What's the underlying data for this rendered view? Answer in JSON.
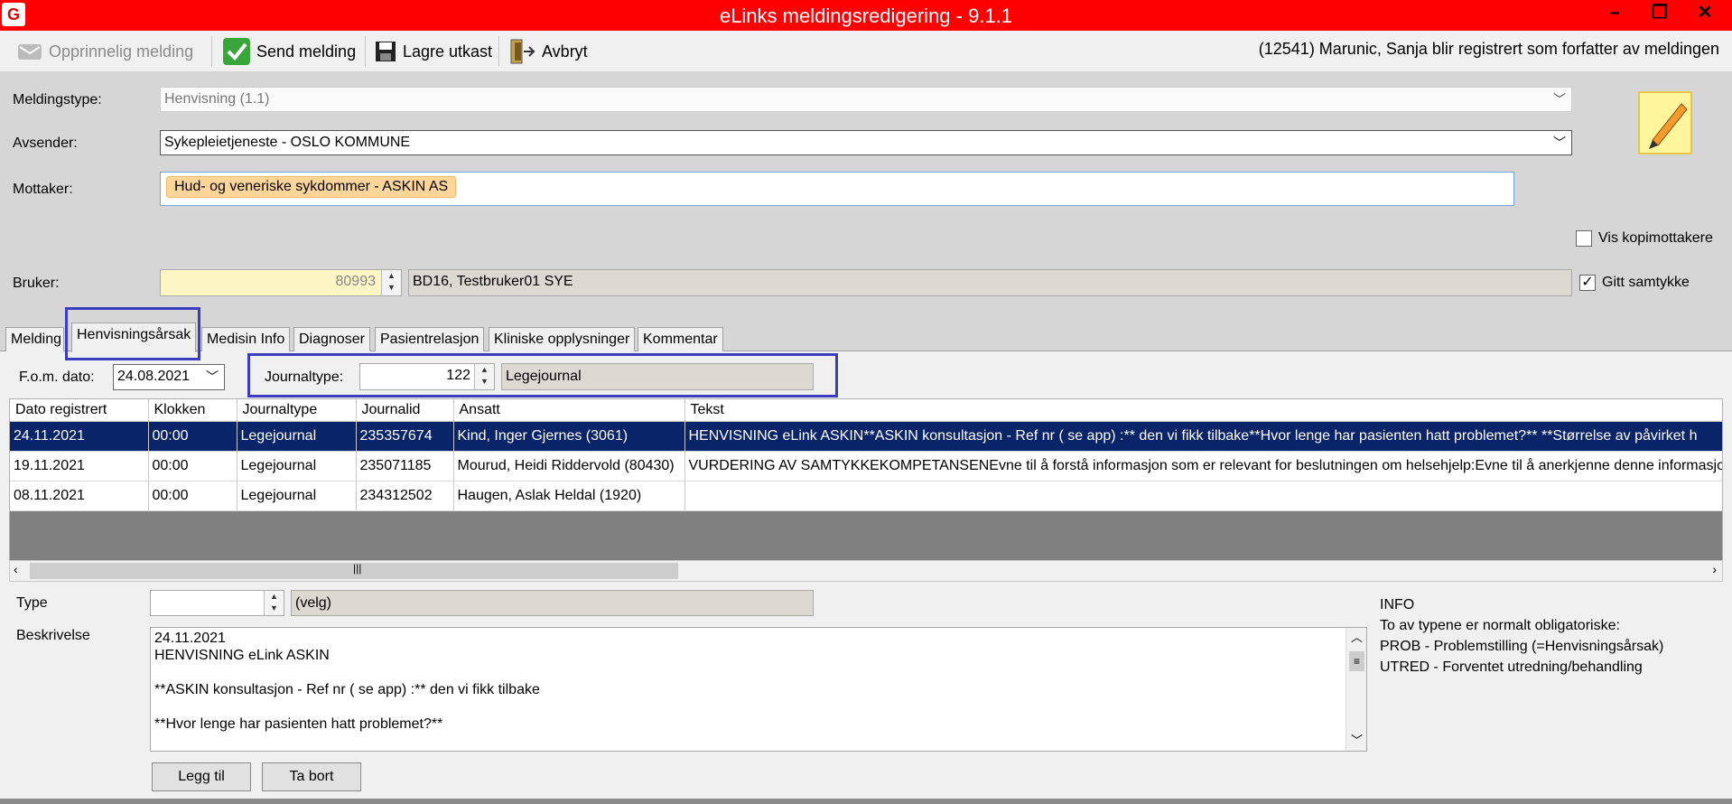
{
  "window": {
    "title": "eLinks meldingsredigering - 9.1.1",
    "app_icon": "G",
    "controls": [
      "minimize-icon",
      "restore-icon",
      "close-icon"
    ]
  },
  "toolbar": {
    "original_label": "Opprinnelig melding",
    "send_label": "Send melding",
    "save_label": "Lagre utkast",
    "cancel_label": "Avbryt",
    "author_note": "(12541) Marunic, Sanja blir registrert som forfatter av meldingen"
  },
  "form": {
    "message_type_label": "Meldingstype:",
    "message_type_value": "Henvisning (1.1)",
    "sender_label": "Avsender:",
    "sender_value": "Sykepleietjeneste - OSLO KOMMUNE",
    "recipient_label": "Mottaker:",
    "recipient_value": "Hud- og veneriske sykdommer - ASKIN AS",
    "copy_recipients_label": "Vis kopimottakere",
    "copy_recipients_checked": false,
    "user_label": "Bruker:",
    "user_id": "80993",
    "user_name": "BD16, Testbruker01 SYE",
    "consent_label": "Gitt samtykke",
    "consent_checked": true
  },
  "tabs": [
    {
      "label": "Melding",
      "active": false
    },
    {
      "label": "Henvisningsårsak",
      "active": true
    },
    {
      "label": "Medisin Info",
      "active": false
    },
    {
      "label": "Diagnoser",
      "active": false
    },
    {
      "label": "Pasientrelasjon",
      "active": false
    },
    {
      "label": "Kliniske opplysninger",
      "active": false
    },
    {
      "label": "Kommentar",
      "active": false
    }
  ],
  "filters": {
    "from_date_label": "F.o.m. dato:",
    "from_date_value": "24.08.2021",
    "journal_type_label": "Journaltype:",
    "journal_type_code": "122",
    "journal_type_name": "Legejournal"
  },
  "grid": {
    "columns": [
      "Dato registrert",
      "Klokken",
      "Journaltype",
      "Journalid",
      "Ansatt",
      "Tekst"
    ],
    "rows": [
      {
        "cells": [
          "24.11.2021",
          "00:00",
          "Legejournal",
          "235357674",
          "Kind, Inger Gjernes (3061)",
          "HENVISNING eLink ASKIN**ASKIN konsultasjon - Ref nr ( se app) :** den vi fikk tilbake**Hvor lenge har pasienten hatt problemet?** **Størrelse av påvirket h"
        ],
        "selected": true
      },
      {
        "cells": [
          "19.11.2021",
          "00:00",
          "Legejournal",
          "235071185",
          "Mourud, Heidi Riddervold (80430)",
          "VURDERING AV SAMTYKKEKOMPETANSENEvne til å forstå informasjon som er relevant for beslutningen om helsehjelp:Evne til å anerkjenne denne informasjone"
        ],
        "selected": false
      },
      {
        "cells": [
          "08.11.2021",
          "00:00",
          "Legejournal",
          "234312502",
          "Haugen, Aslak Heldal (1920)",
          ""
        ],
        "selected": false
      }
    ]
  },
  "detail": {
    "type_label": "Type",
    "type_value": "",
    "type_name": "(velg)",
    "description_label": "Beskrivelse",
    "description_text": "24.11.2021\nHENVISNING eLink ASKIN\n\n**ASKIN konsultasjon - Ref nr ( se app) :** den vi fikk tilbake\n\n**Hvor lenge har pasienten hatt problemet?**",
    "add_label": "Legg til",
    "remove_label": "Ta bort"
  },
  "info": {
    "heading": "INFO",
    "line1": "To av typene er normalt obligatoriske:",
    "line2": "PROB - Problemstilling (=Henvisningsårsak)",
    "line3": "UTRED - Forventet utredning/behandling"
  }
}
